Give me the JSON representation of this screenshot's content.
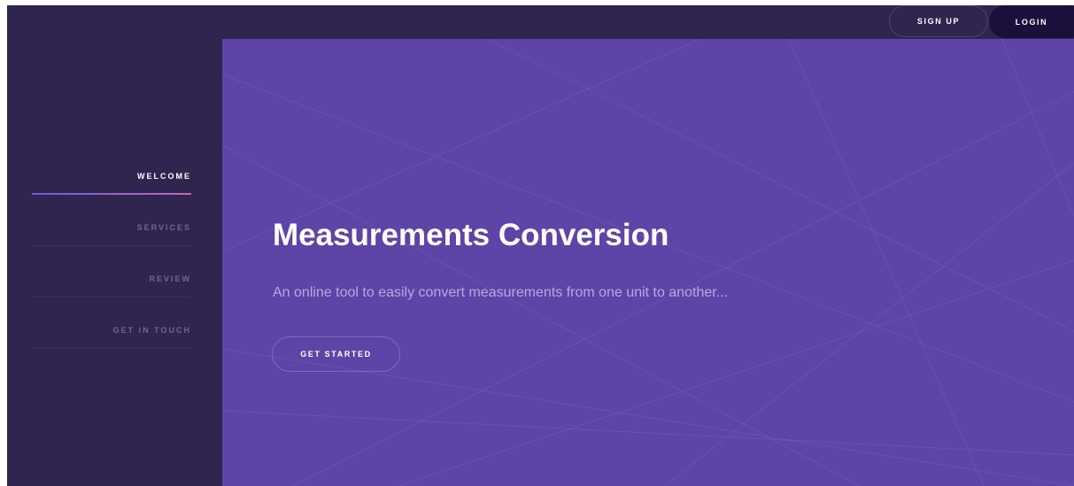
{
  "header": {
    "signup_label": "SIGN UP",
    "login_label": "LOGIN"
  },
  "sidebar": {
    "items": [
      {
        "label": "WELCOME",
        "active": true
      },
      {
        "label": "SERVICES",
        "active": false
      },
      {
        "label": "REVIEW",
        "active": false
      },
      {
        "label": "GET IN TOUCH",
        "active": false
      }
    ]
  },
  "hero": {
    "title": "Measurements Conversion",
    "subtitle": "An online tool to easily convert measurements from one unit to another...",
    "cta_label": "GET STARTED"
  },
  "colors": {
    "frame_bg": "#30254e",
    "hero_bg": "#5e44a6",
    "login_bg": "#1b0f3c",
    "subtitle_text": "#b8a8dd",
    "nav_inactive_text": "#6f6592",
    "nav_active_underline_start": "#6a5be2",
    "nav_active_underline_end": "#c06ab5"
  }
}
